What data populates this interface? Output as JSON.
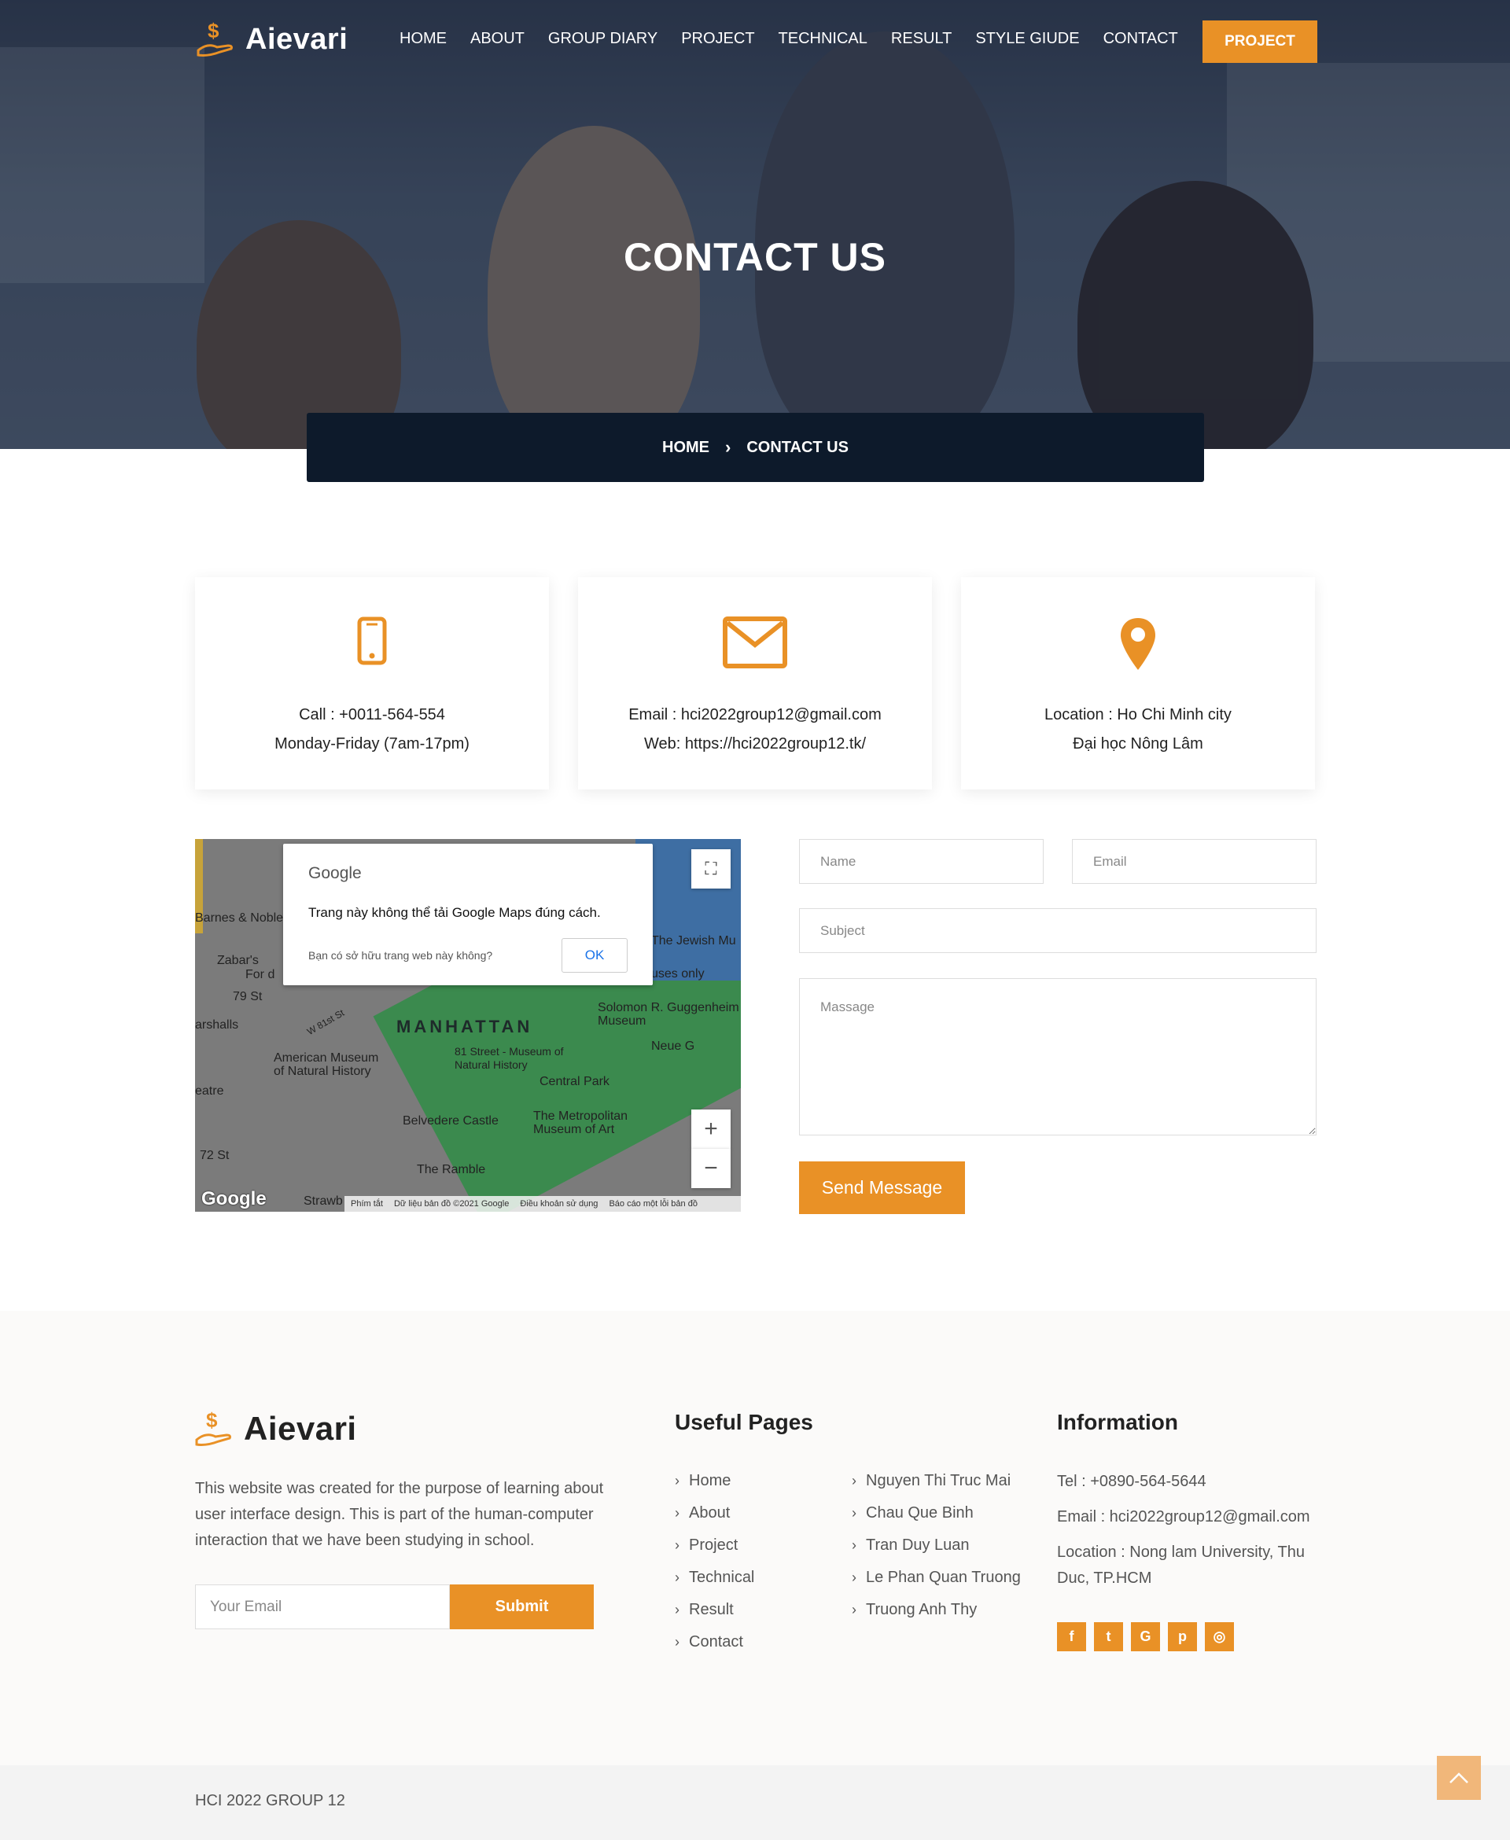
{
  "brand": {
    "name": "Aievari",
    "accent": "#e99126",
    "dark": "#0d1a2b"
  },
  "nav": {
    "items": [
      "HOME",
      "ABOUT",
      "GROUP DIARY",
      "PROJECT",
      "TECHNICAL",
      "RESULT",
      "STYLE GIUDE",
      "CONTACT"
    ],
    "cta": "PROJECT"
  },
  "hero": {
    "title": "CONTACT US"
  },
  "breadcrumb": {
    "home": "HOME",
    "current": "CONTACT US"
  },
  "cards": [
    {
      "icon": "mobile-phone-icon",
      "line1": "Call : +0011-564-554",
      "line2": "Monday-Friday (7am-17pm)"
    },
    {
      "icon": "envelope-icon",
      "line1": "Email : hci2022group12@gmail.com",
      "line2": "Web: https://hci2022group12.tk/"
    },
    {
      "icon": "map-pin-icon",
      "line1": "Location : Ho Chi Minh city",
      "line2": "Đại học Nông Lâm"
    }
  ],
  "map": {
    "dialog_brand": "Google",
    "dialog_message": "Trang này không thể tải Google Maps đúng cách.",
    "dialog_question": "Bạn có sở hữu trang web này không?",
    "dialog_ok": "OK",
    "labels": {
      "manhattan": "MANHATTAN",
      "amnh": "American Museum of Natural History",
      "central_park": "Central Park",
      "met": "The Metropolitan Museum of Art",
      "belvedere": "Belvedere Castle",
      "ramble": "The Ramble",
      "guggenheim": "Solomon R. Guggenheim Museum",
      "jewish": "The Jewish Mu",
      "barnes": "Barnes & Noble",
      "zabars": "Zabar's",
      "st79": "79 St",
      "st72": "72 St",
      "w81": "W 81st St",
      "street81": "81 Street - Museum of Natural History",
      "uses_only": "uses only",
      "for_d": "For d",
      "neue": "Neue G",
      "arshalls": "arshalls",
      "eatre": "eatre",
      "strawb": "Strawb",
      "google": "Google"
    },
    "footer": [
      "Phím tắt",
      "Dữ liệu bản đồ ©2021 Google",
      "Điều khoản sử dụng",
      "Báo cáo một lỗi bản đồ"
    ]
  },
  "form": {
    "name_placeholder": "Name",
    "email_placeholder": "Email",
    "subject_placeholder": "Subject",
    "message_placeholder": "Massage",
    "send_label": "Send Message"
  },
  "footer": {
    "description": "This website was created for the purpose of learning about user interface design. This is part of the human-computer interaction that we have been studying in school.",
    "email_placeholder": "Your Email",
    "submit_label": "Submit",
    "useful_heading": "Useful Pages",
    "pages": [
      "Home",
      "About",
      "Project",
      "Technical",
      "Result",
      "Contact"
    ],
    "members": [
      "Nguyen Thi Truc Mai",
      "Chau Que Binh",
      "Tran Duy Luan",
      "Le Phan Quan Truong",
      "Truong Anh Thy"
    ],
    "info_heading": "Information",
    "tel": "Tel : +0890-564-5644",
    "email": "Email : hci2022group12@gmail.com",
    "location": "Location : Nong lam University, Thu Duc, TP.HCM",
    "socials": [
      {
        "icon": "facebook-icon",
        "glyph": "f"
      },
      {
        "icon": "twitter-icon",
        "glyph": "t"
      },
      {
        "icon": "google-icon",
        "glyph": "G"
      },
      {
        "icon": "pinterest-icon",
        "glyph": "p"
      },
      {
        "icon": "instagram-icon",
        "glyph": "◎"
      }
    ]
  },
  "copyright": "HCI 2022 GROUP 12"
}
